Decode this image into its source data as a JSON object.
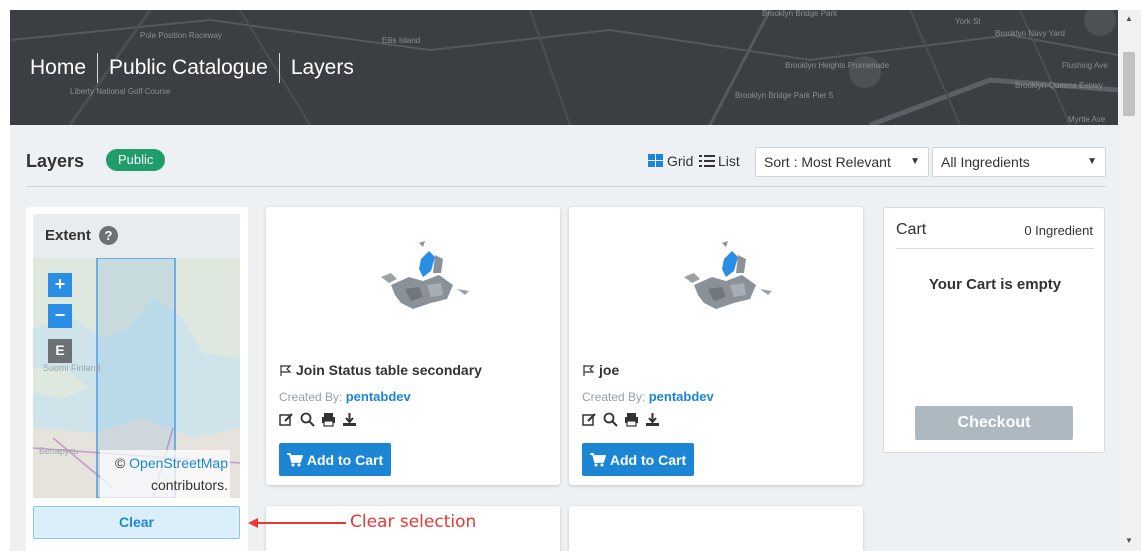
{
  "breadcrumb": [
    "Home",
    "Public Catalogue",
    "Layers"
  ],
  "hero_map_labels": [
    "Pole Position Raceway",
    "Ellis Island",
    "Liberty National Golf Course",
    "Brooklyn Bridge Park",
    "York St",
    "Brooklyn Navy Yard",
    "Flushing Ave",
    "Brooklyn Heights Promenade",
    "Brooklyn Bridge Park Pier 5",
    "Brooklyn-Queens Expwy",
    "Myrtle Ave"
  ],
  "toolbar": {
    "title": "Layers",
    "badge": "Public",
    "grid_label": "Grid",
    "list_label": "List",
    "sort_value": "Sort : Most Relevant",
    "ingredients_value": "All Ingredients"
  },
  "extent": {
    "title": "Extent",
    "help": "?",
    "zoom_in": "+",
    "zoom_out": "−",
    "extent_button": "E",
    "map_labels": [
      "Suomi Finland",
      "Беларусь"
    ],
    "attribution_symbol": "©",
    "attribution_link": "OpenStreetMap",
    "attribution_rest": "contributors.",
    "clear_label": "Clear"
  },
  "cards": [
    {
      "title": "Join Status table secondary",
      "created_by_label": "Created By:",
      "author": "pentabdev",
      "add_label": "Add to Cart"
    },
    {
      "title": "joe",
      "created_by_label": "Created By:",
      "author": "pentabdev",
      "add_label": "Add to Cart"
    }
  ],
  "cart": {
    "title": "Cart",
    "count": "0 Ingredient",
    "empty_message": "Your Cart is empty",
    "checkout_label": "Checkout"
  },
  "annotation": "Clear selection",
  "colors": {
    "accent": "#1c86d4",
    "badge": "#1f9d6b",
    "checkout_disabled": "#aeb8c0",
    "annotation": "#e53935"
  }
}
